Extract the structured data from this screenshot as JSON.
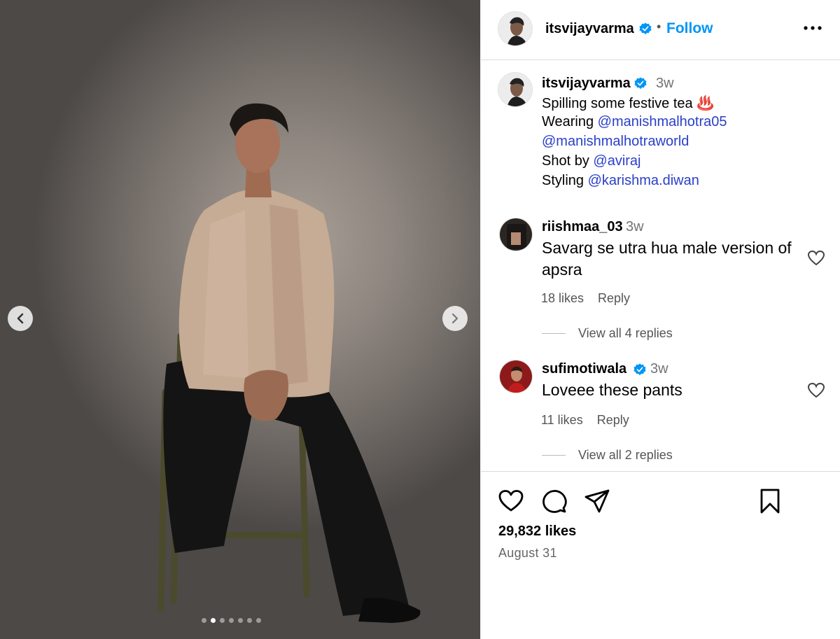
{
  "post": {
    "username": "itsvijayvarma",
    "follow_label": "Follow",
    "separator": "•",
    "time_ago": "3w",
    "caption_lines": [
      {
        "text": "Spilling some festive tea ♨️"
      },
      {
        "prefix": "Wearing ",
        "mention": "@manishmalhotra05"
      },
      {
        "prefix": "",
        "mention": "@manishmalhotraworld"
      },
      {
        "prefix": "Shot by ",
        "mention": "@aviraj"
      },
      {
        "prefix": "Styling ",
        "mention": "@karishma.diwan"
      }
    ],
    "likes": "29,832 likes",
    "date": "August 31",
    "carousel": {
      "count": 7,
      "active_index": 1
    }
  },
  "comments": [
    {
      "username": "riishmaa_03",
      "verified": false,
      "time_ago": "3w",
      "text": "Savarg se utra hua male version of apsra",
      "likes": "18 likes",
      "reply_label": "Reply",
      "view_replies": "View all 4 replies"
    },
    {
      "username": "sufimotiwala",
      "verified": true,
      "time_ago": "3w",
      "text": "Loveee these pants",
      "likes": "11 likes",
      "reply_label": "Reply",
      "view_replies": "View all 2 replies"
    }
  ],
  "icons": {
    "verified": "verified-badge-icon",
    "more": "more-horizontal-icon",
    "like": "heart-icon",
    "comment": "comment-bubble-icon",
    "share": "paper-plane-icon",
    "save": "bookmark-icon",
    "prev": "chevron-left-icon",
    "next": "chevron-right-icon"
  },
  "colors": {
    "follow": "#0095f6",
    "mention": "#2a3fc9",
    "verified": "#0095f6",
    "muted": "#737373"
  }
}
